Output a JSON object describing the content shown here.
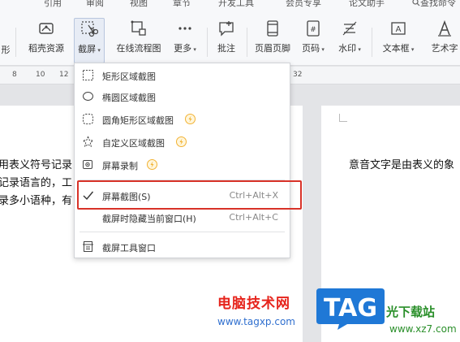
{
  "menubar": {
    "tabs": [
      "引用",
      "审阅",
      "视图",
      "章节",
      "开发工具",
      "会员专享",
      "论文助手"
    ],
    "search": "查找命令"
  },
  "ribbon": {
    "left_partial": "形",
    "buttons": [
      {
        "label": "稻壳资源",
        "icon": "docer-icon"
      },
      {
        "label": "截屏",
        "icon": "screenshot-scissors-icon",
        "active": true
      },
      {
        "label": "在线流程图",
        "icon": "flowchart-icon"
      },
      {
        "label": "更多",
        "icon": "more-icon"
      },
      {
        "label": "批注",
        "icon": "comment-icon"
      },
      {
        "label": "页眉页脚",
        "icon": "header-footer-icon"
      },
      {
        "label": "页码",
        "icon": "page-number-icon"
      },
      {
        "label": "水印",
        "icon": "watermark-icon"
      },
      {
        "label": "文本框",
        "icon": "textbox-icon"
      },
      {
        "label": "艺术字",
        "icon": "wordart-icon"
      }
    ]
  },
  "ruler": {
    "ticks": [
      "8",
      "10",
      "12",
      "32"
    ]
  },
  "document": {
    "page1_lines": [
      "用表义符号记录",
      "记录语言的，工",
      "录多小语种，有"
    ],
    "page2_line": "意音文字是由表义的象"
  },
  "screenshot_menu": {
    "items": [
      {
        "label": "矩形区域截图",
        "icon": "rectangle-select-icon"
      },
      {
        "label": "椭圆区域截图",
        "icon": "ellipse-select-icon"
      },
      {
        "label": "圆角矩形区域截图",
        "icon": "rounded-rect-select-icon",
        "vip": true
      },
      {
        "label": "自定义区域截图",
        "icon": "freeform-select-icon",
        "vip": true
      },
      {
        "label": "屏幕录制",
        "icon": "screen-record-icon",
        "vip": true
      },
      {
        "label": "屏幕截图(S)",
        "shortcut": "Ctrl+Alt+X",
        "checked": true
      },
      {
        "label": "截屏时隐藏当前窗口(H)",
        "shortcut": "Ctrl+Alt+C"
      },
      {
        "label": "截屏工具窗口",
        "icon": "screenshot-toolbar-icon"
      }
    ]
  },
  "watermark": {
    "site_name": "电脑技术网",
    "site_url": "www.tagxp.com",
    "logo_text": "TAG",
    "partner_name": "光下载站",
    "partner_url": "www.xz7.com"
  },
  "colors": {
    "highlight": "#d83228",
    "vip_badge": "#f2b233",
    "logo_blue": "#1f78d6",
    "watermark_red": "#e6241c"
  }
}
